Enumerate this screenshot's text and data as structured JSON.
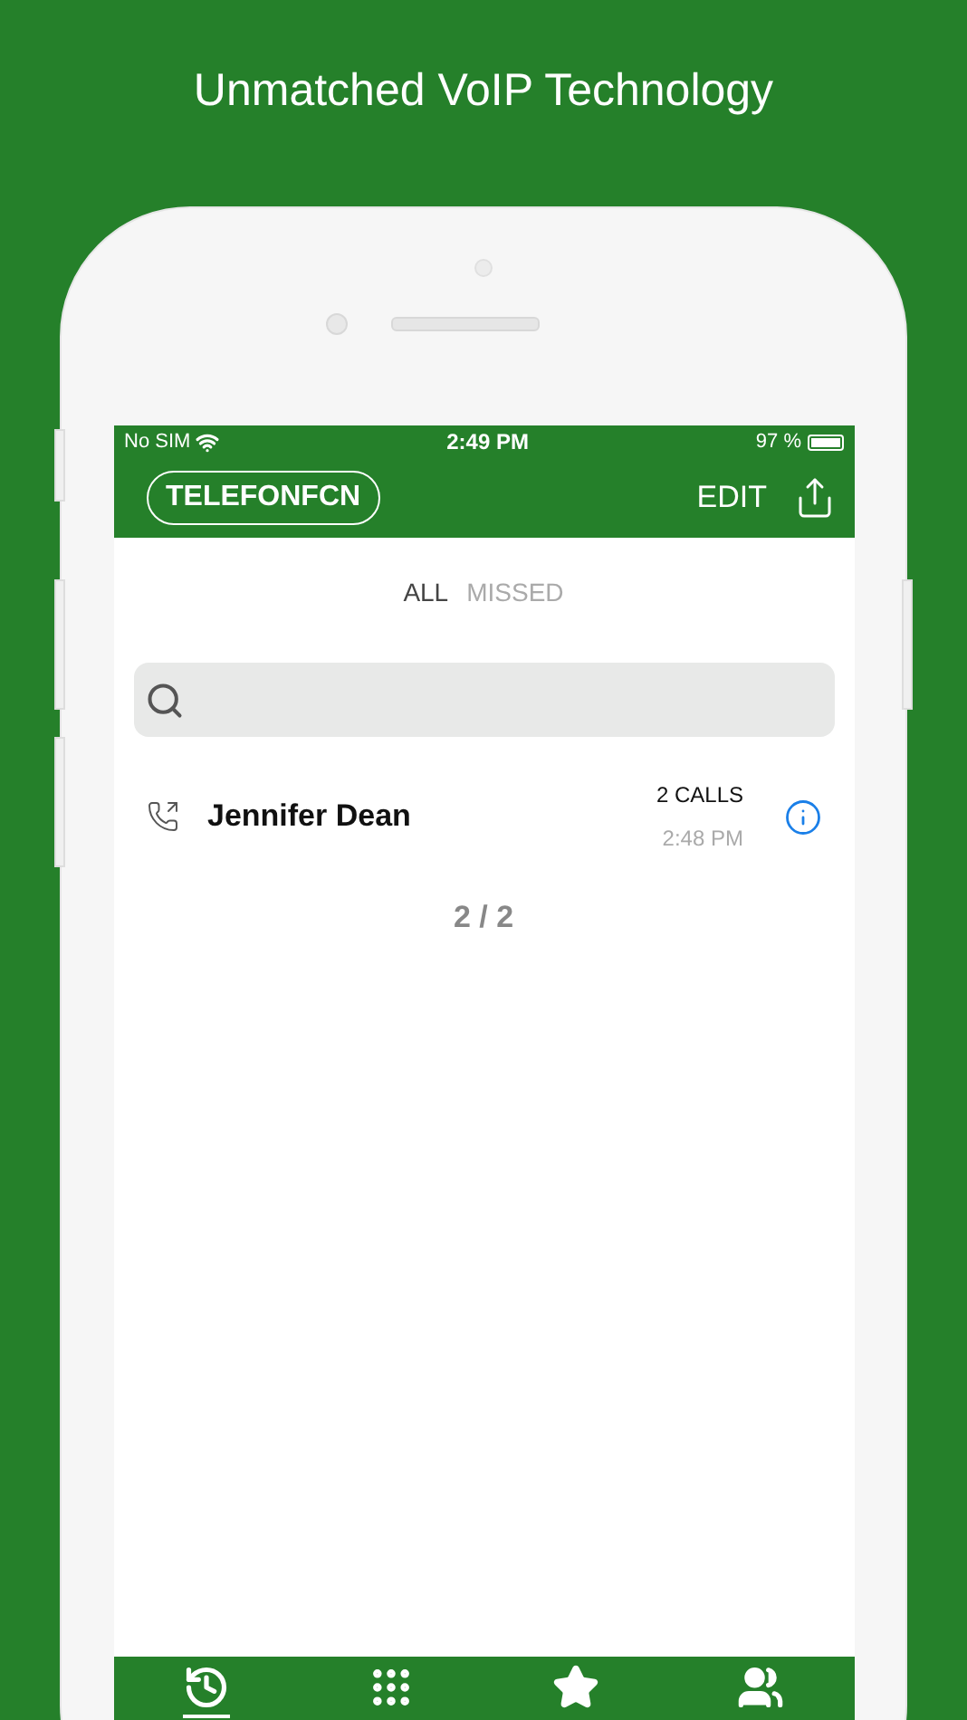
{
  "headline": "Unmatched VoIP Technology",
  "status_bar": {
    "carrier": "No SIM",
    "time": "2:49 PM",
    "battery": "97 %"
  },
  "nav_bar": {
    "logo": "TELEFONFCN",
    "edit": "EDIT"
  },
  "filter_tabs": [
    {
      "label": "ALL",
      "selected": true
    },
    {
      "label": "MISSED",
      "selected": false
    }
  ],
  "calls": [
    {
      "name": "Jennifer Dean",
      "count": "2 CALLS",
      "time": "2:48 PM"
    }
  ],
  "pager": "2 / 2",
  "bottom_tabs": [
    {
      "kind": "history",
      "selected": true
    },
    {
      "kind": "keypad",
      "selected": false
    },
    {
      "kind": "favorites",
      "selected": false
    },
    {
      "kind": "contacts",
      "selected": false
    }
  ]
}
